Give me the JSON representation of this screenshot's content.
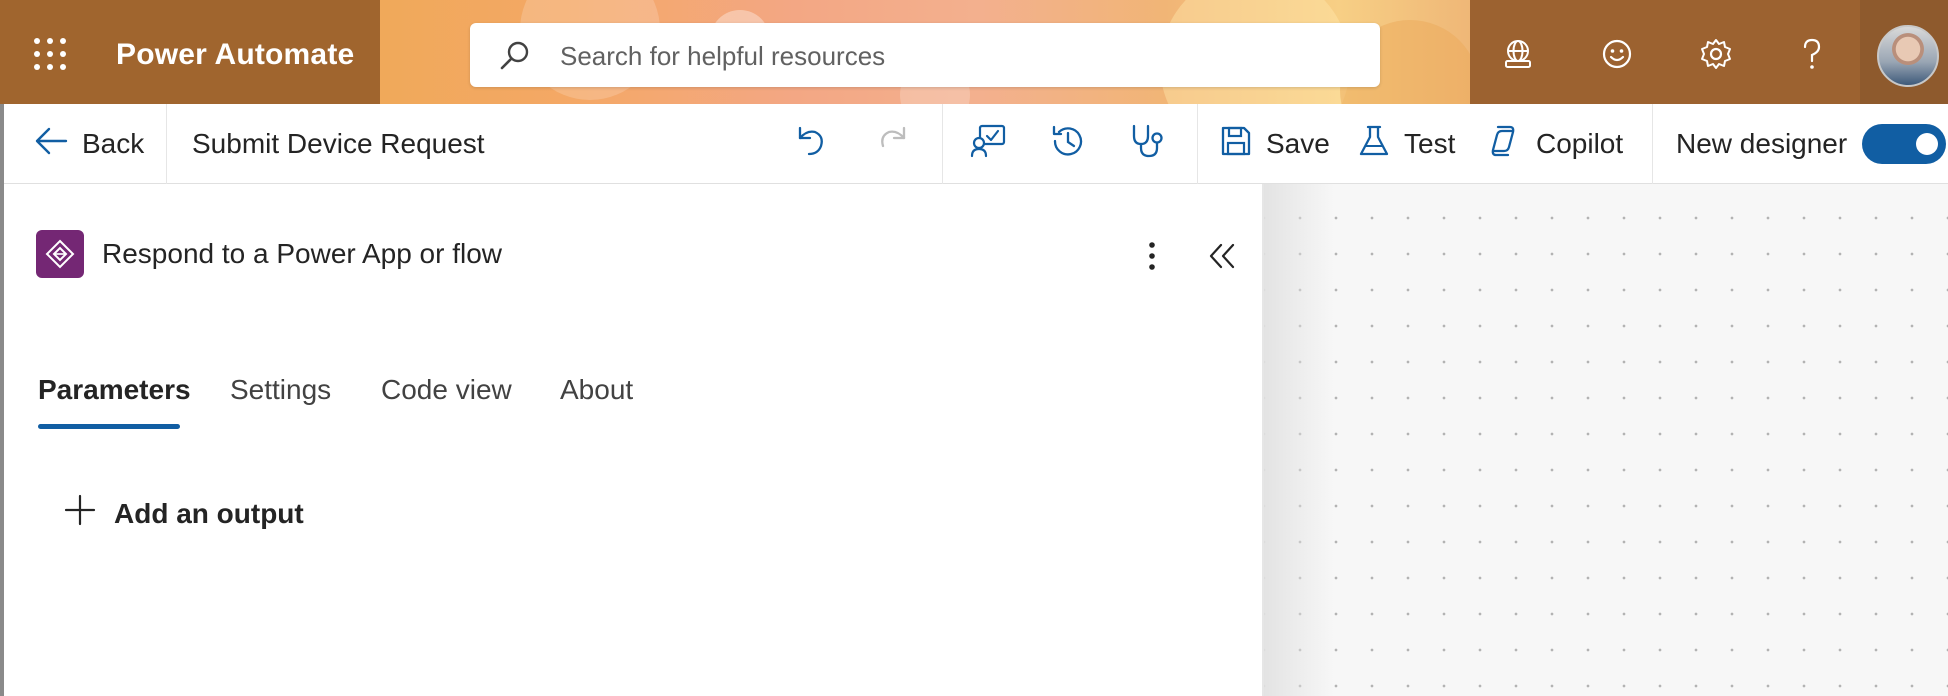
{
  "header": {
    "app_title": "Power Automate",
    "search": {
      "placeholder": "Search for helpful resources"
    },
    "icons": [
      "app-launcher-icon",
      "environment-globe-icon",
      "feedback-smiley-icon",
      "settings-gear-icon",
      "help-question-icon"
    ],
    "banner_colors": [
      "#a0652e",
      "#f0a95a",
      "#f3a784",
      "#f7cf85"
    ]
  },
  "command_bar": {
    "back_label": "Back",
    "flow_name": "Submit Device Request",
    "save_label": "Save",
    "test_label": "Test",
    "copilot_label": "Copilot",
    "new_designer_label": "New designer",
    "new_designer_enabled": true,
    "undo_enabled": true,
    "redo_enabled": false,
    "accent_color": "#115ea3"
  },
  "panel": {
    "operation_title": "Respond to a Power App or flow",
    "operation_icon_color": "#742774",
    "tabs": [
      {
        "label": "Parameters",
        "active": true
      },
      {
        "label": "Settings",
        "active": false
      },
      {
        "label": "Code view",
        "active": false
      },
      {
        "label": "About",
        "active": false
      }
    ],
    "add_output_label": "Add an output"
  }
}
